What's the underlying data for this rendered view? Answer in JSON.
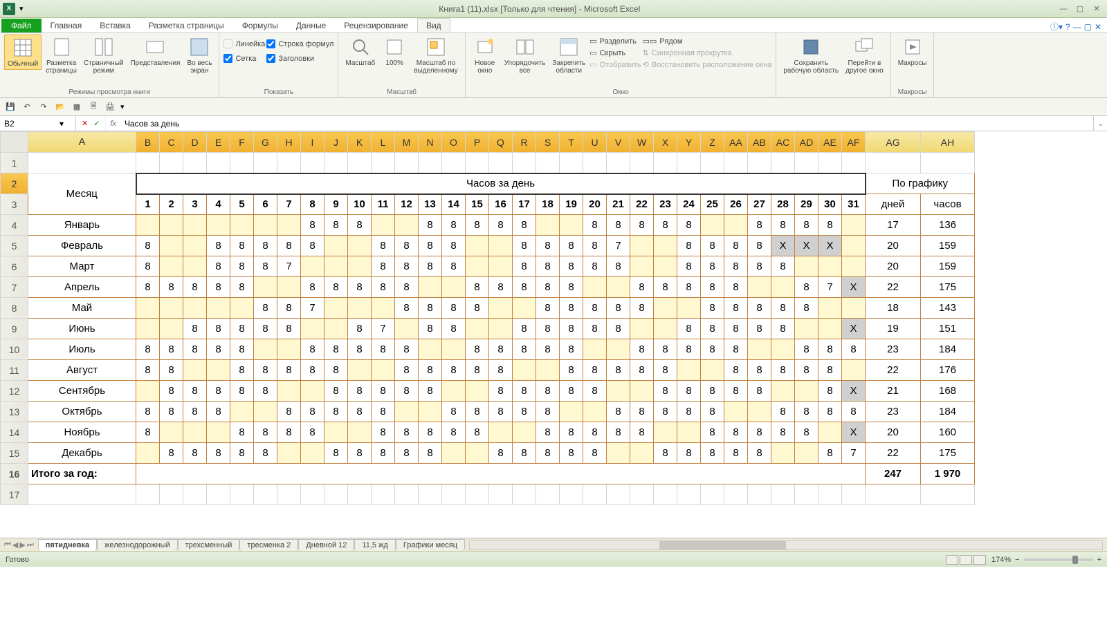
{
  "title": "Книга1 (11).xlsx  [Только для чтения]  -  Microsoft Excel",
  "tabs": {
    "file": "Файл",
    "home": "Главная",
    "insert": "Вставка",
    "layout": "Разметка страницы",
    "formulas": "Формулы",
    "data": "Данные",
    "review": "Рецензирование",
    "view": "Вид"
  },
  "ribbon": {
    "g1": {
      "normal": "Обычный",
      "page": "Разметка\nстраницы",
      "break": "Страничный\nрежим",
      "custom": "Представления",
      "full": "Во весь\nэкран",
      "label": "Режимы просмотра книги"
    },
    "g2": {
      "ruler": "Линейка",
      "formula": "Строка формул",
      "grid": "Сетка",
      "headings": "Заголовки",
      "label": "Показать"
    },
    "g3": {
      "zoom": "Масштаб",
      "z100": "100%",
      "zsel": "Масштаб по\nвыделенному",
      "label": "Масштаб"
    },
    "g4": {
      "neww": "Новое\nокно",
      "arrange": "Упорядочить\nвсе",
      "freeze": "Закрепить\nобласти",
      "split": "Разделить",
      "hide": "Скрыть",
      "unhide": "Отобразить",
      "side": "Рядом",
      "sync": "Синхронная прокрутка",
      "reset": "Восстановить расположение окна",
      "label": "Окно"
    },
    "g5": {
      "save": "Сохранить\nрабочую область",
      "switch": "Перейти в\nдругое окно"
    },
    "g6": {
      "macros": "Макросы",
      "label": "Макросы"
    }
  },
  "namebox": "B2",
  "formula": "Часов за день",
  "cols": [
    "A",
    "B",
    "C",
    "D",
    "E",
    "F",
    "G",
    "H",
    "I",
    "J",
    "K",
    "L",
    "M",
    "N",
    "O",
    "P",
    "Q",
    "R",
    "S",
    "T",
    "U",
    "V",
    "W",
    "X",
    "Y",
    "Z",
    "AA",
    "AB",
    "AC",
    "AD",
    "AE",
    "AF",
    "AG",
    "AH"
  ],
  "hdr": {
    "month": "Месяц",
    "hours_day": "Часов за день",
    "schedule": "По графику",
    "days": "дней",
    "hours": "часов"
  },
  "day_nums": [
    "1",
    "2",
    "3",
    "4",
    "5",
    "6",
    "7",
    "8",
    "9",
    "10",
    "11",
    "12",
    "13",
    "14",
    "15",
    "16",
    "17",
    "18",
    "19",
    "20",
    "21",
    "22",
    "23",
    "24",
    "25",
    "26",
    "27",
    "28",
    "29",
    "30",
    "31"
  ],
  "rows": [
    {
      "m": "Январь",
      "d": [
        "",
        "",
        "",
        "",
        "",
        "",
        "",
        "8",
        "8",
        "8",
        "",
        "",
        "8",
        "8",
        "8",
        "8",
        "8",
        "",
        "",
        "8",
        "8",
        "8",
        "8",
        "8",
        "",
        "",
        "8",
        "8",
        "8",
        "8",
        ""
      ],
      "ag": "17",
      "ah": "136",
      "y": [
        0,
        1,
        2,
        3,
        4,
        5,
        6,
        10,
        11,
        17,
        18,
        24,
        25,
        30
      ]
    },
    {
      "m": "Февраль",
      "d": [
        "8",
        "",
        "",
        "8",
        "8",
        "8",
        "8",
        "8",
        "",
        "",
        "8",
        "8",
        "8",
        "8",
        "",
        "",
        "8",
        "8",
        "8",
        "8",
        "7",
        "",
        "",
        "8",
        "8",
        "8",
        "8",
        "X",
        "X",
        "X",
        ""
      ],
      "ag": "20",
      "ah": "159",
      "y": [
        1,
        2,
        8,
        9,
        14,
        15,
        21,
        22,
        30
      ],
      "g": [
        27,
        28,
        29
      ]
    },
    {
      "m": "Март",
      "d": [
        "8",
        "",
        "",
        "8",
        "8",
        "8",
        "7",
        "",
        "",
        "",
        "8",
        "8",
        "8",
        "8",
        "",
        "",
        "8",
        "8",
        "8",
        "8",
        "8",
        "",
        "",
        "8",
        "8",
        "8",
        "8",
        "8",
        "",
        "",
        ""
      ],
      "ag": "20",
      "ah": "159",
      "y": [
        1,
        2,
        7,
        8,
        9,
        14,
        15,
        21,
        22,
        28,
        29,
        30
      ]
    },
    {
      "m": "Апрель",
      "d": [
        "8",
        "8",
        "8",
        "8",
        "8",
        "",
        "",
        "8",
        "8",
        "8",
        "8",
        "8",
        "",
        "",
        "8",
        "8",
        "8",
        "8",
        "8",
        "",
        "",
        "8",
        "8",
        "8",
        "8",
        "8",
        "",
        "",
        "8",
        "7",
        "X"
      ],
      "ag": "22",
      "ah": "175",
      "y": [
        5,
        6,
        12,
        13,
        19,
        20,
        26,
        27
      ],
      "g": [
        30
      ]
    },
    {
      "m": "Май",
      "d": [
        "",
        "",
        "",
        "",
        "",
        "8",
        "8",
        "7",
        "",
        "",
        "",
        "8",
        "8",
        "8",
        "8",
        "",
        "",
        "8",
        "8",
        "8",
        "8",
        "8",
        "",
        "",
        "8",
        "8",
        "8",
        "8",
        "8",
        "",
        ""
      ],
      "ag": "18",
      "ah": "143",
      "y": [
        0,
        1,
        2,
        3,
        4,
        8,
        9,
        10,
        15,
        16,
        22,
        23,
        29,
        30
      ]
    },
    {
      "m": "Июнь",
      "d": [
        "",
        "",
        "8",
        "8",
        "8",
        "8",
        "8",
        "",
        "",
        "8",
        "7",
        "",
        "8",
        "8",
        "",
        "",
        "8",
        "8",
        "8",
        "8",
        "8",
        "",
        "",
        "8",
        "8",
        "8",
        "8",
        "8",
        "",
        "",
        "X"
      ],
      "ag": "19",
      "ah": "151",
      "y": [
        0,
        1,
        7,
        8,
        11,
        14,
        15,
        21,
        22,
        28,
        29
      ],
      "g": [
        30
      ]
    },
    {
      "m": "Июль",
      "d": [
        "8",
        "8",
        "8",
        "8",
        "8",
        "",
        "",
        "8",
        "8",
        "8",
        "8",
        "8",
        "",
        "",
        "8",
        "8",
        "8",
        "8",
        "8",
        "",
        "",
        "8",
        "8",
        "8",
        "8",
        "8",
        "",
        "",
        "8",
        "8",
        "8"
      ],
      "ag": "23",
      "ah": "184",
      "y": [
        5,
        6,
        12,
        13,
        19,
        20,
        26,
        27
      ]
    },
    {
      "m": "Август",
      "d": [
        "8",
        "8",
        "",
        "",
        "8",
        "8",
        "8",
        "8",
        "8",
        "",
        "",
        "8",
        "8",
        "8",
        "8",
        "8",
        "",
        "",
        "8",
        "8",
        "8",
        "8",
        "8",
        "",
        "",
        "8",
        "8",
        "8",
        "8",
        "8",
        ""
      ],
      "ag": "22",
      "ah": "176",
      "y": [
        2,
        3,
        9,
        10,
        16,
        17,
        23,
        24,
        30
      ]
    },
    {
      "m": "Сентябрь",
      "d": [
        "",
        "8",
        "8",
        "8",
        "8",
        "8",
        "",
        "",
        "8",
        "8",
        "8",
        "8",
        "8",
        "",
        "",
        "8",
        "8",
        "8",
        "8",
        "8",
        "",
        "",
        "8",
        "8",
        "8",
        "8",
        "8",
        "",
        "",
        "8",
        "X"
      ],
      "ag": "21",
      "ah": "168",
      "y": [
        0,
        6,
        7,
        13,
        14,
        20,
        21,
        27,
        28
      ],
      "g": [
        30
      ]
    },
    {
      "m": "Октябрь",
      "d": [
        "8",
        "8",
        "8",
        "8",
        "",
        "",
        "8",
        "8",
        "8",
        "8",
        "8",
        "",
        "",
        "8",
        "8",
        "8",
        "8",
        "8",
        "",
        "",
        "8",
        "8",
        "8",
        "8",
        "8",
        "",
        "",
        "8",
        "8",
        "8",
        "8"
      ],
      "ag": "23",
      "ah": "184",
      "y": [
        4,
        5,
        11,
        12,
        18,
        19,
        25,
        26
      ]
    },
    {
      "m": "Ноябрь",
      "d": [
        "8",
        "",
        "",
        "",
        "8",
        "8",
        "8",
        "8",
        "",
        "",
        "8",
        "8",
        "8",
        "8",
        "8",
        "",
        "",
        "8",
        "8",
        "8",
        "8",
        "8",
        "",
        "",
        "8",
        "8",
        "8",
        "8",
        "8",
        "",
        "X"
      ],
      "ag": "20",
      "ah": "160",
      "y": [
        1,
        2,
        3,
        8,
        9,
        15,
        16,
        22,
        23,
        29
      ],
      "g": [
        30
      ]
    },
    {
      "m": "Декабрь",
      "d": [
        "",
        "8",
        "8",
        "8",
        "8",
        "8",
        "",
        "",
        "8",
        "8",
        "8",
        "8",
        "8",
        "",
        "",
        "8",
        "8",
        "8",
        "8",
        "8",
        "",
        "",
        "8",
        "8",
        "8",
        "8",
        "8",
        "",
        "",
        "8",
        "7"
      ],
      "ag": "22",
      "ah": "175",
      "y": [
        0,
        6,
        7,
        13,
        14,
        20,
        21,
        27,
        28
      ]
    }
  ],
  "total": {
    "label": "Итого за год:",
    "ag": "247",
    "ah": "1 970"
  },
  "sheets": [
    "пятидневка",
    "железнодорожный",
    "трехсменный",
    "тресменка 2",
    "Дневной 12",
    "11,5 жд",
    "Графики месяц"
  ],
  "status": "Готово",
  "zoom": "174%"
}
